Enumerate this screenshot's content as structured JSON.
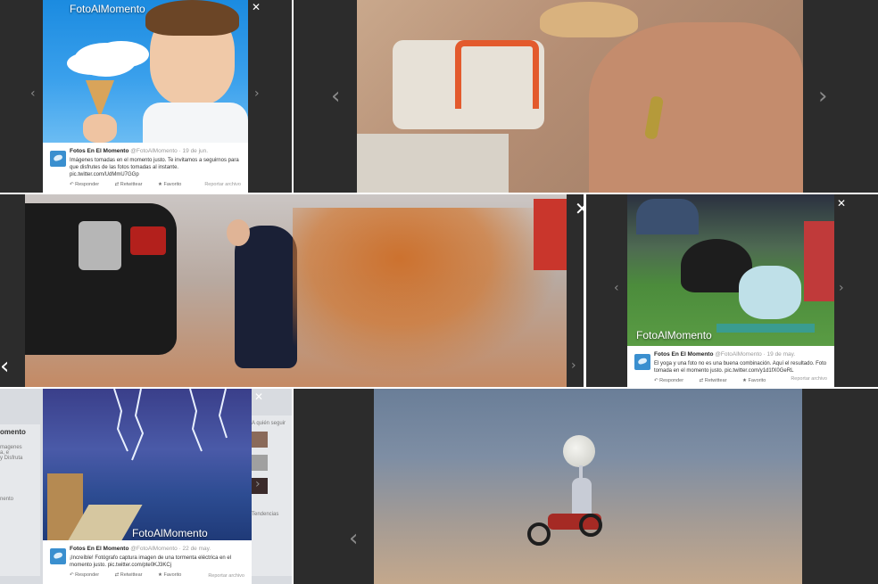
{
  "panels": [
    {
      "watermark": "FotoAlMomento",
      "tweet": {
        "author": "Fotos En El Momento",
        "handle": "@FotoAlMomento",
        "date": "· 19 de jun.",
        "text": "Imágenes tomadas en el momento justo. Te invitamos a seguirnos para que disfrutes de las fotos tomadas al instante.",
        "link": "pic.twitter.com/UdMmU7GGp",
        "reply": "Responder",
        "retweet": "Retwittear",
        "favorite": "Favorito",
        "report": "Reportar archivo"
      }
    },
    {},
    {},
    {
      "watermark": "FotoAlMomento",
      "tweet": {
        "author": "Fotos En El Momento",
        "handle": "@FotoAlMomento",
        "date": "· 19 de may.",
        "text": "El yoga y una foto no es una buena combinación. Aquí el resultado. Foto tomada en el momento justo.",
        "link": "pic.twitter.com/y1d1fX0GeRL",
        "reply": "Responder",
        "retweet": "Retwittear",
        "favorite": "Favorito",
        "report": "Reportar archivo"
      }
    },
    {
      "watermark": "FotoAlMomento",
      "side_left": [
        "omento",
        "magenes",
        "a, e",
        "y Disfruta",
        "nento"
      ],
      "side_right": [
        "A quién seguir",
        "Tendencias"
      ],
      "tweet": {
        "author": "Fotos En El Momento",
        "handle": "@FotoAlMomento",
        "date": "· 22 de may.",
        "text": "¡Increíble! Fotógrafo captura imagen de una tormenta eléctrica en el momento justo.",
        "link": "pic.twitter.com/pte0KJ3KCj",
        "reply": "Responder",
        "retweet": "Retwittear",
        "favorite": "Favorito",
        "report": "Reportar archivo"
      }
    },
    {}
  ],
  "icons": {
    "prev": "chevron-left-icon",
    "next": "chevron-right-icon",
    "close": "close-icon"
  },
  "colors": {
    "panel_bg": "#2c2c2c",
    "twitter_blue": "#3a8fcf"
  }
}
